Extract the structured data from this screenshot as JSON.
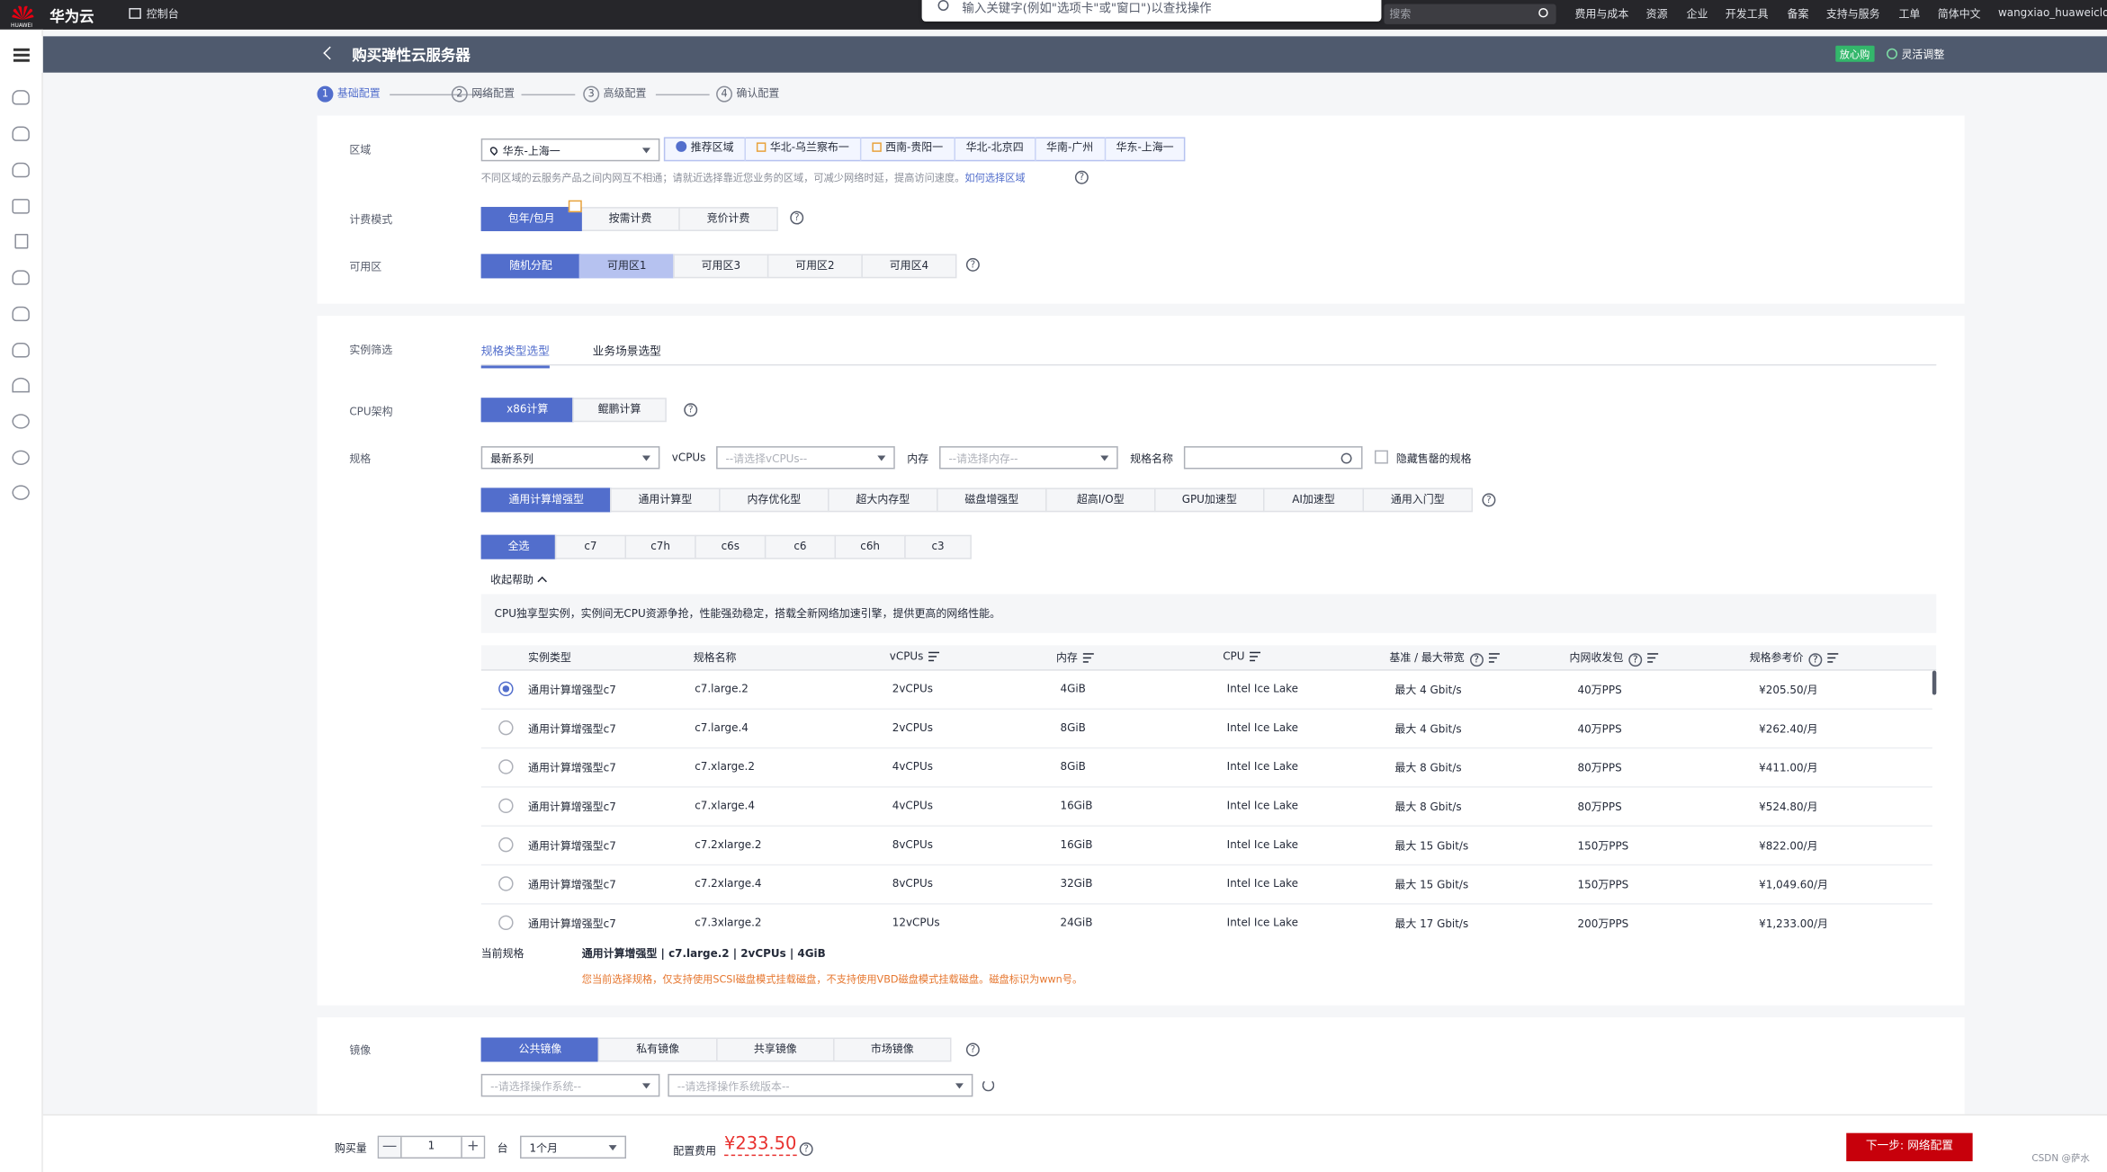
{
  "topbar": {
    "brand_name": "华为云",
    "brand_small": "HUAWEI",
    "console": "控制台",
    "global_search_placeholder": "输入关键字(例如\"选项卡\"或\"窗口\")以查找操作",
    "search_placeholder": "搜索",
    "nav": [
      "费用与成本",
      "资源",
      "企业",
      "开发工具",
      "备案",
      "支持与服务",
      "工单",
      "简体中文",
      "wangxiao_huaweiclou"
    ]
  },
  "header": {
    "title": "购买弹性云服务器",
    "badge": "放心购",
    "flex": "灵活调整"
  },
  "steps": [
    {
      "num": "1",
      "label": "基础配置"
    },
    {
      "num": "2",
      "label": "网络配置"
    },
    {
      "num": "3",
      "label": "高级配置"
    },
    {
      "num": "4",
      "label": "确认配置"
    }
  ],
  "basic": {
    "region_label": "区域",
    "region_value": "华东-上海一",
    "region_recommend": "推荐区域",
    "region_options": [
      "华北-乌兰察布一",
      "西南-贵阳一",
      "华北-北京四",
      "华南-广州",
      "华东-上海一"
    ],
    "region_note": "不同区域的云服务产品之间内网互不相通；请就近选择靠近您业务的区域，可减少网络时延，提高访问速度。",
    "region_link": "如何选择区域",
    "billing_label": "计费模式",
    "billing_options": [
      "包年/包月",
      "按需计费",
      "竞价计费"
    ],
    "az_label": "可用区",
    "az_options": [
      "随机分配",
      "可用区1",
      "可用区3",
      "可用区2",
      "可用区4"
    ]
  },
  "instance": {
    "filter_label": "实例筛选",
    "tabs": [
      "规格类型选型",
      "业务场景选型"
    ],
    "cpu_label": "CPU架构",
    "cpu_options": [
      "x86计算",
      "鲲鹏计算"
    ],
    "spec_label": "规格",
    "series_value": "最新系列",
    "vcpus_label": "vCPUs",
    "vcpus_placeholder": "--请选择vCPUs--",
    "mem_label": "内存",
    "mem_placeholder": "--请选择内存--",
    "name_label": "规格名称",
    "hide_soldout": "隐藏售罄的规格",
    "types": [
      "通用计算增强型",
      "通用计算型",
      "内存优化型",
      "超大内存型",
      "磁盘增强型",
      "超高I/O型",
      "GPU加速型",
      "AI加速型",
      "通用入门型"
    ],
    "series": [
      "全选",
      "c7",
      "c7h",
      "c6s",
      "c6",
      "c6h",
      "c3"
    ],
    "collapse": "收起帮助",
    "help": "CPU独享型实例，实例间无CPU资源争抢，性能强劲稳定，搭载全新网络加速引擎，提供更高的网络性能。",
    "columns": [
      "实例类型",
      "规格名称",
      "vCPUs",
      "内存",
      "CPU",
      "基准 / 最大带宽",
      "内网收发包",
      "规格参考价"
    ],
    "rows": [
      [
        "通用计算增强型c7",
        "c7.large.2",
        "2vCPUs",
        "4GiB",
        "Intel Ice Lake",
        "最大 4 Gbit/s",
        "40万PPS",
        "¥205.50/月"
      ],
      [
        "通用计算增强型c7",
        "c7.large.4",
        "2vCPUs",
        "8GiB",
        "Intel Ice Lake",
        "最大 4 Gbit/s",
        "40万PPS",
        "¥262.40/月"
      ],
      [
        "通用计算增强型c7",
        "c7.xlarge.2",
        "4vCPUs",
        "8GiB",
        "Intel Ice Lake",
        "最大 8 Gbit/s",
        "80万PPS",
        "¥411.00/月"
      ],
      [
        "通用计算增强型c7",
        "c7.xlarge.4",
        "4vCPUs",
        "16GiB",
        "Intel Ice Lake",
        "最大 8 Gbit/s",
        "80万PPS",
        "¥524.80/月"
      ],
      [
        "通用计算增强型c7",
        "c7.2xlarge.2",
        "8vCPUs",
        "16GiB",
        "Intel Ice Lake",
        "最大 15 Gbit/s",
        "150万PPS",
        "¥822.00/月"
      ],
      [
        "通用计算增强型c7",
        "c7.2xlarge.4",
        "8vCPUs",
        "32GiB",
        "Intel Ice Lake",
        "最大 15 Gbit/s",
        "150万PPS",
        "¥1,049.60/月"
      ],
      [
        "通用计算增强型c7",
        "c7.3xlarge.2",
        "12vCPUs",
        "24GiB",
        "Intel Ice Lake",
        "最大 17 Gbit/s",
        "200万PPS",
        "¥1,233.00/月"
      ]
    ],
    "current_label": "当前规格",
    "current_value": "通用计算增强型 | c7.large.2 | 2vCPUs | 4GiB",
    "warning": "您当前选择规格，仅支持使用SCSI磁盘模式挂载磁盘，不支持使用VBD磁盘模式挂载磁盘。磁盘标识为wwn号。"
  },
  "image": {
    "label": "镜像",
    "options": [
      "公共镜像",
      "私有镜像",
      "共享镜像",
      "市场镜像"
    ],
    "os_placeholder": "--请选择操作系统--",
    "ver_placeholder": "--请选择操作系统版本--"
  },
  "footer": {
    "qty_label": "购买量",
    "minus": "—",
    "qty": "1",
    "plus": "+",
    "unit": "台",
    "duration": "1个月",
    "fee_label": "配置费用",
    "fee": "¥233.50",
    "next": "下一步: 网络配置",
    "watermark": "CSDN @萨水"
  }
}
